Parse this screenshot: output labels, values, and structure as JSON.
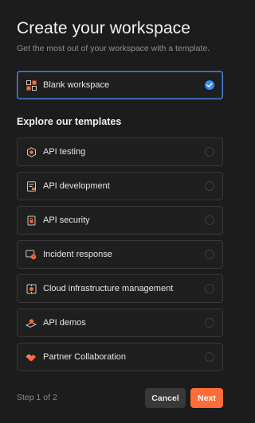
{
  "header": {
    "title": "Create your workspace",
    "subtitle": "Get the most out of your workspace with a template."
  },
  "blank_option": {
    "label": "Blank workspace",
    "selected": true
  },
  "templates_section": {
    "heading": "Explore our templates",
    "items": [
      {
        "label": "API testing",
        "icon": "api-testing-icon"
      },
      {
        "label": "API development",
        "icon": "api-development-icon"
      },
      {
        "label": "API security",
        "icon": "api-security-icon"
      },
      {
        "label": "Incident response",
        "icon": "incident-response-icon"
      },
      {
        "label": "Cloud infrastructure management",
        "icon": "cloud-infrastructure-icon"
      },
      {
        "label": "API demos",
        "icon": "api-demos-icon"
      },
      {
        "label": "Partner Collaboration",
        "icon": "partner-collaboration-icon"
      }
    ]
  },
  "footer": {
    "step": "Step 1 of 2",
    "cancel_label": "Cancel",
    "next_label": "Next"
  },
  "colors": {
    "background": "#1c1c1c",
    "accent": "#ff6c37",
    "selected_border": "#4a86d9",
    "check": "#3a8df0"
  }
}
